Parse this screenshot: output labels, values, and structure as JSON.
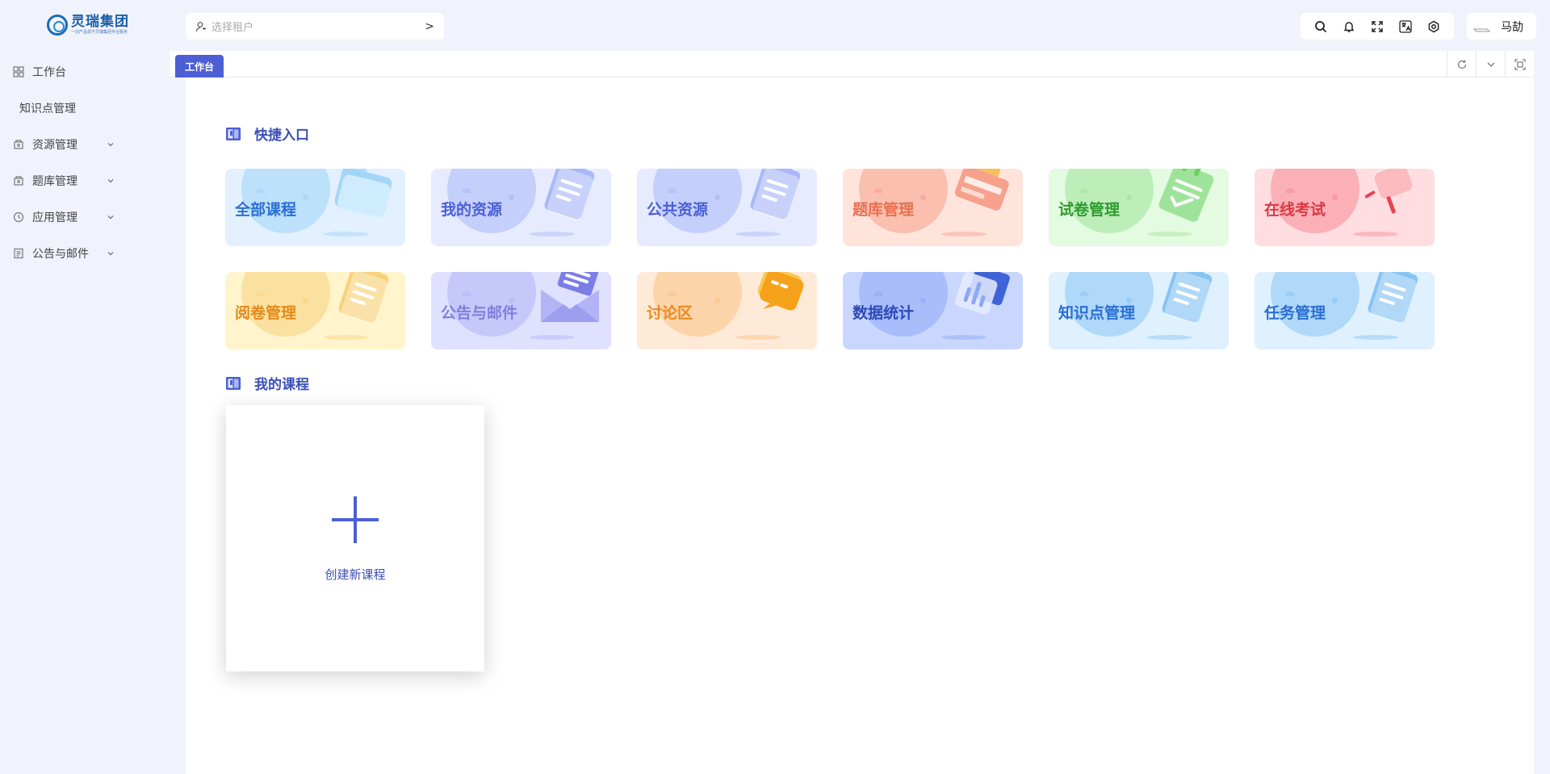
{
  "brand": {
    "name": "灵瑞集团",
    "tagline": "一切产品源于灵瑞集团专业服务"
  },
  "sidebar": {
    "items": [
      {
        "label": "工作台",
        "icon": "grid-icon",
        "has_children": false
      },
      {
        "label": "知识点管理",
        "icon": "",
        "has_children": false
      },
      {
        "label": "资源管理",
        "icon": "resource-icon",
        "has_children": true
      },
      {
        "label": "题库管理",
        "icon": "resource-icon",
        "has_children": true
      },
      {
        "label": "应用管理",
        "icon": "clock-icon",
        "has_children": true
      },
      {
        "label": "公告与邮件",
        "icon": "notice-icon",
        "has_children": true
      }
    ]
  },
  "header": {
    "tenant_placeholder": "选择租户",
    "tools": [
      "search-icon",
      "bell-icon",
      "fullscreen-icon",
      "translate-icon",
      "settings-icon"
    ],
    "user_name": "马劼"
  },
  "tabs": {
    "active": "工作台"
  },
  "quick": {
    "title": "快捷入口",
    "cards": [
      {
        "label": "全部课程",
        "text_color": "#2a6fd4",
        "bg": "#e2f0ff",
        "accent": "#9fd3f7",
        "art": "folder"
      },
      {
        "label": "我的资源",
        "text_color": "#4a5fd6",
        "bg": "#e6ebff",
        "accent": "#a9b8f7",
        "art": "clipboard"
      },
      {
        "label": "公共资源",
        "text_color": "#4a5fd6",
        "bg": "#e6ebff",
        "accent": "#a9b8f7",
        "art": "clipboard"
      },
      {
        "label": "题库管理",
        "text_color": "#e86f4f",
        "bg": "#ffe4dc",
        "accent": "#f7a08c",
        "art": "card"
      },
      {
        "label": "试卷管理",
        "text_color": "#2e9a2e",
        "bg": "#e3fbe0",
        "accent": "#9fe39a",
        "art": "notepad"
      },
      {
        "label": "在线考试",
        "text_color": "#d83a45",
        "bg": "#ffdde0",
        "accent": "#f58b93",
        "art": "flag"
      },
      {
        "label": "阅卷管理",
        "text_color": "#e48a1a",
        "bg": "#fff4cc",
        "accent": "#f7d27a",
        "art": "clipboard"
      },
      {
        "label": "公告与邮件",
        "text_color": "#7f80dd",
        "bg": "#e0e0ff",
        "accent": "#b3b4f5",
        "art": "mail"
      },
      {
        "label": "讨论区",
        "text_color": "#e88a22",
        "bg": "#ffead8",
        "accent": "#f9c183",
        "art": "chat"
      },
      {
        "label": "数据统计",
        "text_color": "#2d49b5",
        "bg": "#c9d7ff",
        "accent": "#8da7f4",
        "art": "chart"
      },
      {
        "label": "知识点管理",
        "text_color": "#2a6fd4",
        "bg": "#dff0ff",
        "accent": "#88c4f3",
        "art": "clipboard"
      },
      {
        "label": "任务管理",
        "text_color": "#2a6fd4",
        "bg": "#dff0ff",
        "accent": "#88c4f3",
        "art": "clipboard"
      }
    ]
  },
  "courses": {
    "title": "我的课程",
    "new_label": "创建新课程"
  }
}
